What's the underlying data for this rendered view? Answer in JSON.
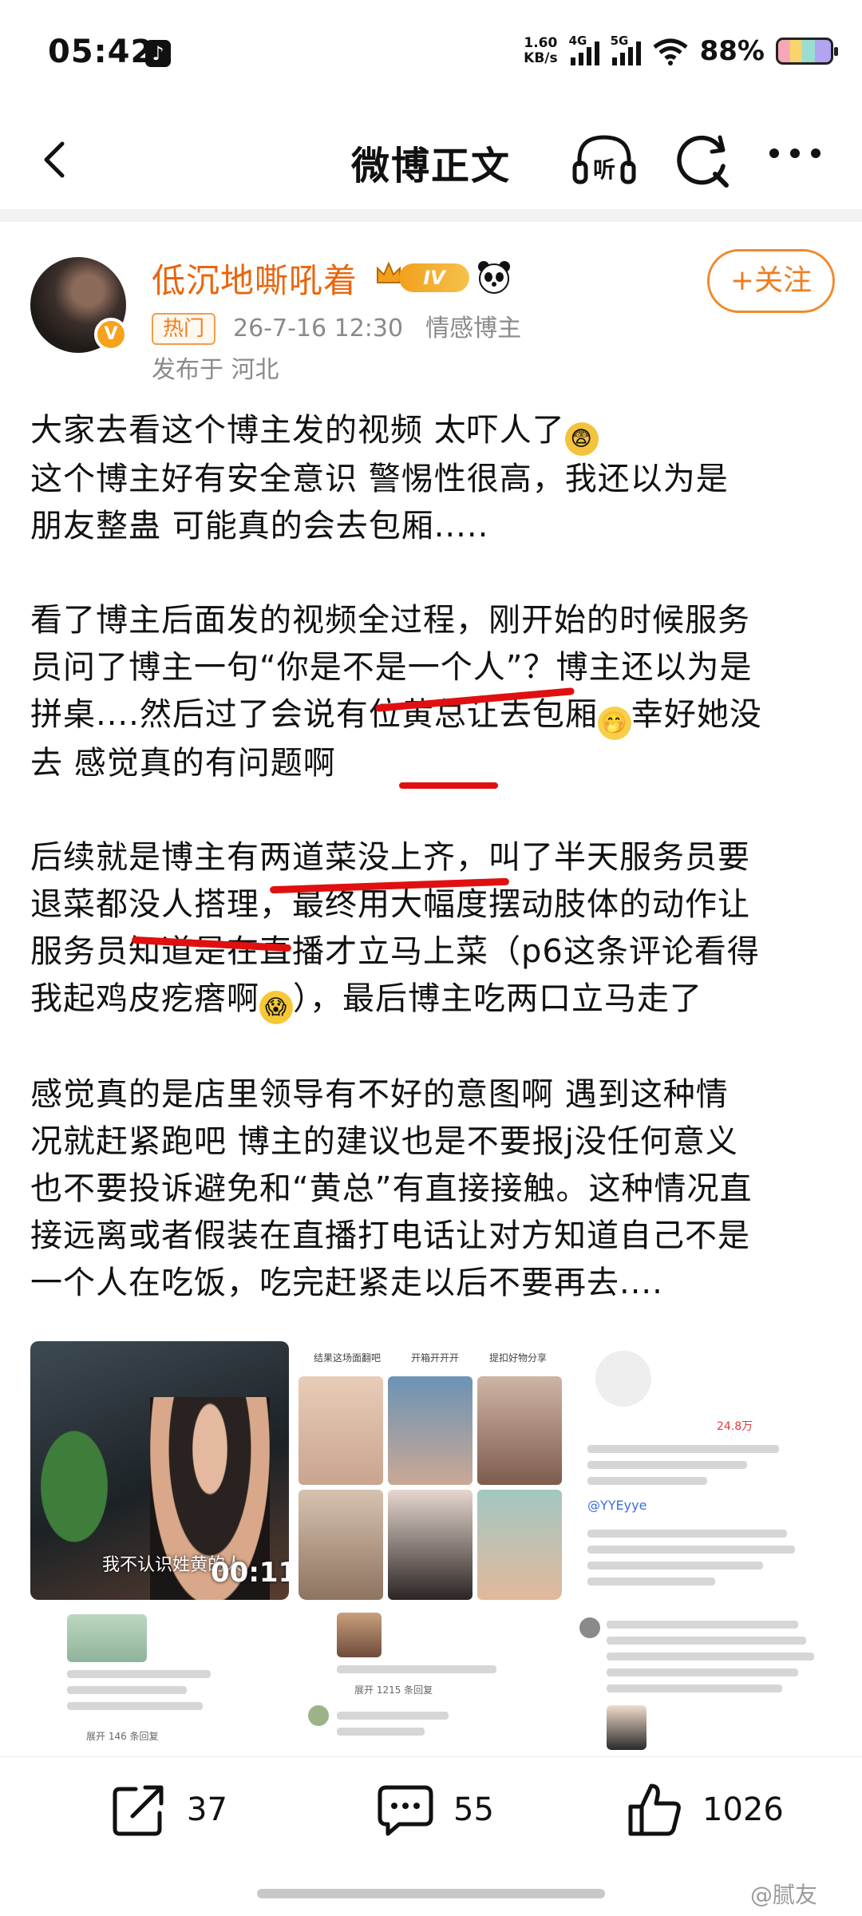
{
  "status_bar": {
    "time": "05:42",
    "net_speed_value": "1.60",
    "net_speed_unit": "KB/s",
    "signal1_label": "4G",
    "signal2_label": "5G",
    "battery_percent": "88%"
  },
  "nav": {
    "title": "微博正文",
    "icons": [
      "back-icon",
      "listen-icon",
      "refresh-search-icon",
      "more-icon"
    ]
  },
  "author": {
    "name": "低沉地嘶吼着",
    "level_badge": "IV",
    "hot_tag": "热门",
    "datetime": "26-7-16 12:30",
    "category": "情感博主",
    "location": "发布于 河北",
    "follow_label": "+关注"
  },
  "post": {
    "p1_line1": "大家去看这个博主发的视频 太吓人了",
    "p1_line2": "这个博主好有安全意识 警惕性很高，我还以为是",
    "p1_line3": "朋友整蛊 可能真的会去包厢.....",
    "p2_line1": "看了博主后面发的视频全过程，刚开始的时候服务",
    "p2_line2": "员问了博主一句“你是不是一个人”？博主还以为是",
    "p2_line3": "拼桌....然后过了会说有位黄总让去包厢",
    "p2_line3_tail": "幸好她没",
    "p2_line4": "去 感觉真的有问题啊",
    "p3_line1": "后续就是博主有两道菜没上齐，叫了半天服务员要",
    "p3_line2": "退菜都没人搭理，最终用大幅度摆动肢体的动作让",
    "p3_line3": "服务员知道是在直播才立马上菜（p6这条评论看得",
    "p3_line4": "我起鸡皮疙瘩啊",
    "p3_line4_tail": "），最后博主吃两口立马走了",
    "p4_line1": "感觉真的是店里领导有不好的意图啊 遇到这种情",
    "p4_line2": "况就赶紧跑吧 博主的建议也是不要报j没任何意义",
    "p4_line3": "也不要投诉避免和“黄总”有直接接触。这种情况直",
    "p4_line4": "接远离或者假装在直播打电话让对方知道自己不是",
    "p4_line5": "一个人在吃饭，吃完赶紧走以后不要再去...."
  },
  "images": {
    "video_subtitle": "我不认识姓黄的人",
    "video_duration": "00:11",
    "img2_tabs": [
      "结果这场面翻吧",
      "开箱开开开",
      "提扣好物分享"
    ],
    "img3_likes": "24.8万",
    "img3_reply_name": "@YYEyye",
    "img5_more": "展开 1215 条回复",
    "img4_more": "展开 146 条回复"
  },
  "actions": {
    "share_count": "37",
    "comment_count": "55",
    "like_count": "1026"
  },
  "watermark": "@腻友"
}
